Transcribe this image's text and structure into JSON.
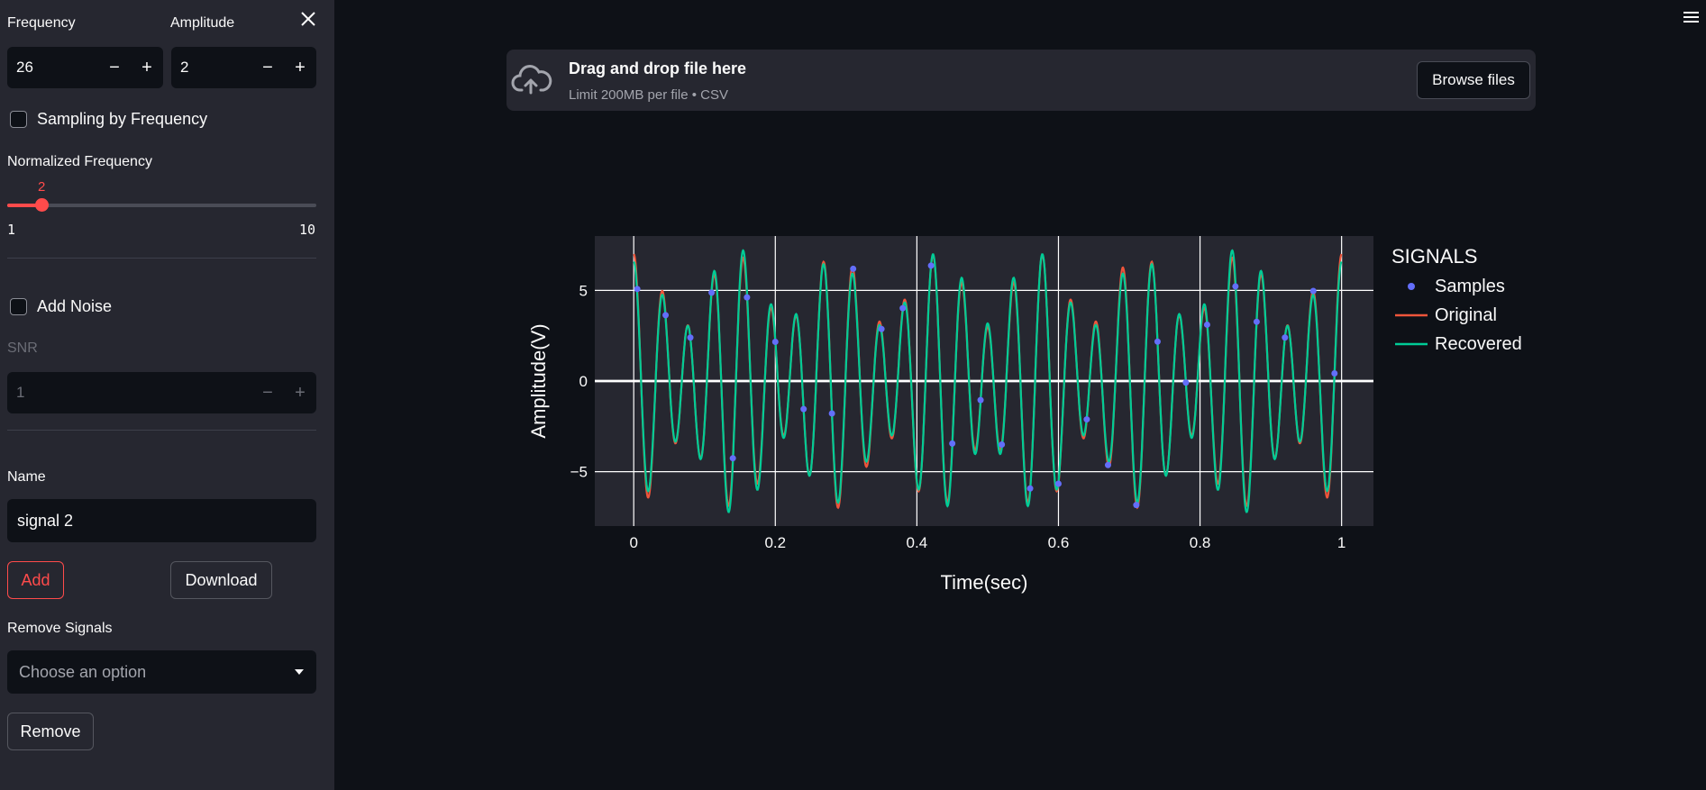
{
  "sidebar": {
    "frequency": {
      "label": "Frequency",
      "value": "26",
      "minus": "−",
      "plus": "+"
    },
    "amplitude": {
      "label": "Amplitude",
      "value": "2",
      "minus": "−",
      "plus": "+"
    },
    "sampling_checkbox": {
      "label": "Sampling by Frequency",
      "checked": false
    },
    "normalized_frequency": {
      "label": "Normalized Frequency",
      "value": "2",
      "min": "1",
      "max": "10",
      "fraction": 0.111
    },
    "noise_checkbox": {
      "label": "Add Noise",
      "checked": false
    },
    "snr": {
      "label": "SNR",
      "value": "1",
      "minus": "−",
      "plus": "+",
      "disabled": true
    },
    "name": {
      "label": "Name",
      "value": "signal 2"
    },
    "add_button": "Add",
    "download_button": "Download",
    "remove_signals": {
      "label": "Remove Signals",
      "placeholder": "Choose an option"
    },
    "remove_button": "Remove",
    "close_icon": "close-icon"
  },
  "uploader": {
    "title": "Drag and drop file here",
    "subtitle": "Limit 200MB per file • CSV",
    "browse_button": "Browse files",
    "icon": "cloud-upload-icon"
  },
  "menu_icon": "hamburger-menu-icon",
  "colors": {
    "accent": "#ff4b4b",
    "samples": "#636efa",
    "original": "#ef553b",
    "recovered": "#00cc96",
    "plot_bg": "#262730",
    "page_bg": "#0e1117"
  },
  "chart_data": {
    "type": "line",
    "xlabel": "Time(sec)",
    "ylabel": "Amplitude(V)",
    "legend_title": "SIGNALS",
    "legend_position": "right",
    "xlim": [
      -0.055,
      1.045
    ],
    "ylim": [
      -8,
      8
    ],
    "xticks": [
      0,
      0.2,
      0.4,
      0.6,
      0.8,
      1
    ],
    "xtick_labels": [
      "0",
      "0.2",
      "0.4",
      "0.6",
      "0.8",
      "1"
    ],
    "yticks": [
      -5,
      0,
      5
    ],
    "ytick_labels": [
      "−5",
      "0",
      "5"
    ],
    "grid": true,
    "series": [
      {
        "name": "Samples",
        "mode": "markers",
        "color": "#636efa"
      },
      {
        "name": "Original",
        "mode": "line",
        "color": "#ef553b"
      },
      {
        "name": "Recovered",
        "mode": "line",
        "color": "#00cc96"
      }
    ],
    "components": [
      {
        "frequency": 26,
        "amplitude": 5
      },
      {
        "frequency": 19,
        "amplitude": 2
      }
    ],
    "samples_x": [
      0.005,
      0.045,
      0.08,
      0.11,
      0.14,
      0.16,
      0.2,
      0.24,
      0.28,
      0.31,
      0.35,
      0.38,
      0.42,
      0.45,
      0.49,
      0.52,
      0.56,
      0.6,
      0.64,
      0.67,
      0.71,
      0.74,
      0.78,
      0.81,
      0.85,
      0.88,
      0.92,
      0.96,
      0.99
    ]
  }
}
